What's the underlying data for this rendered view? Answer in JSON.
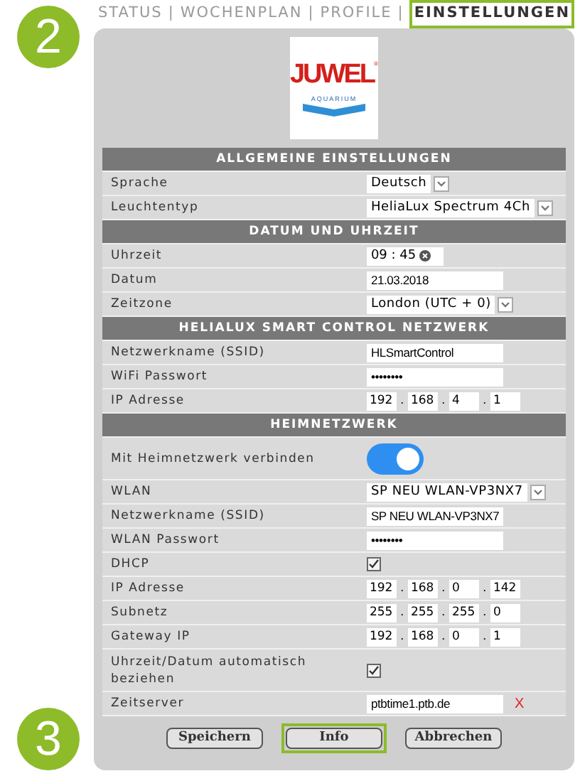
{
  "steps": [
    "2",
    "3"
  ],
  "nav": {
    "separator": "|",
    "items": [
      {
        "label": "STATUS",
        "selected": false
      },
      {
        "label": "WOCHENPLAN",
        "selected": false
      },
      {
        "label": "PROFILE",
        "selected": false
      },
      {
        "label": "EINSTELLUNGEN",
        "selected": true
      }
    ]
  },
  "logo": {
    "brand": "JUWEL",
    "mark": "®",
    "sub": "AQUARIUM"
  },
  "sections": [
    {
      "title": "ALLGEMEINE EINSTELLUNGEN",
      "rows": [
        {
          "kind": "select",
          "label": "Sprache",
          "value": "Deutsch"
        },
        {
          "kind": "select",
          "label": "Leuchtentyp",
          "value": "HeliaLux Spectrum 4Ch"
        }
      ]
    },
    {
      "title": "DATUM UND UHRZEIT",
      "rows": [
        {
          "kind": "time",
          "label": "Uhrzeit",
          "value": "09 : 45"
        },
        {
          "kind": "text",
          "label": "Datum",
          "value": "21.03.2018"
        },
        {
          "kind": "select",
          "label": "Zeitzone",
          "value": "London (UTC + 0)"
        }
      ]
    },
    {
      "title": "HELIALUX SMART CONTROL NETZWERK",
      "rows": [
        {
          "kind": "text",
          "label": "Netzwerkname (SSID)",
          "value": "HLSmartControl"
        },
        {
          "kind": "text",
          "label": "WiFi Passwort",
          "value": "••••••••"
        },
        {
          "kind": "ip",
          "label": "IP Adresse",
          "separator": ".",
          "octets": [
            "192",
            "168",
            "4",
            "1"
          ]
        }
      ]
    },
    {
      "title": "HEIMNETZWERK",
      "rows": [
        {
          "kind": "toggle",
          "label": "Mit Heimnetzwerk verbinden",
          "on": true
        },
        {
          "kind": "select",
          "label": "WLAN",
          "value": "SP NEU WLAN-VP3NX7"
        },
        {
          "kind": "text",
          "label": "Netzwerkname (SSID)",
          "value": "SP NEU WLAN-VP3NX7"
        },
        {
          "kind": "text",
          "label": "WLAN Passwort",
          "value": "••••••••"
        },
        {
          "kind": "checkbox",
          "label": "DHCP",
          "checked": true
        },
        {
          "kind": "ip",
          "label": "IP Adresse",
          "separator": ".",
          "octets": [
            "192",
            "168",
            "0",
            "142"
          ]
        },
        {
          "kind": "ip",
          "label": "Subnetz",
          "separator": ".",
          "octets": [
            "255",
            "255",
            "255",
            "0"
          ]
        },
        {
          "kind": "ip",
          "label": "Gateway IP",
          "separator": ".",
          "octets": [
            "192",
            "168",
            "0",
            "1"
          ]
        },
        {
          "kind": "checkbox",
          "label": "Uhrzeit/Datum automatisch beziehen",
          "checked": true
        },
        {
          "kind": "text",
          "label": "Zeitserver",
          "value": "ptbtime1.ptb.de",
          "error": "X"
        }
      ]
    }
  ],
  "buttons": [
    {
      "label": "Speichern",
      "selected": false
    },
    {
      "label": "Info",
      "selected": true
    },
    {
      "label": "Abbrechen",
      "selected": false
    }
  ]
}
